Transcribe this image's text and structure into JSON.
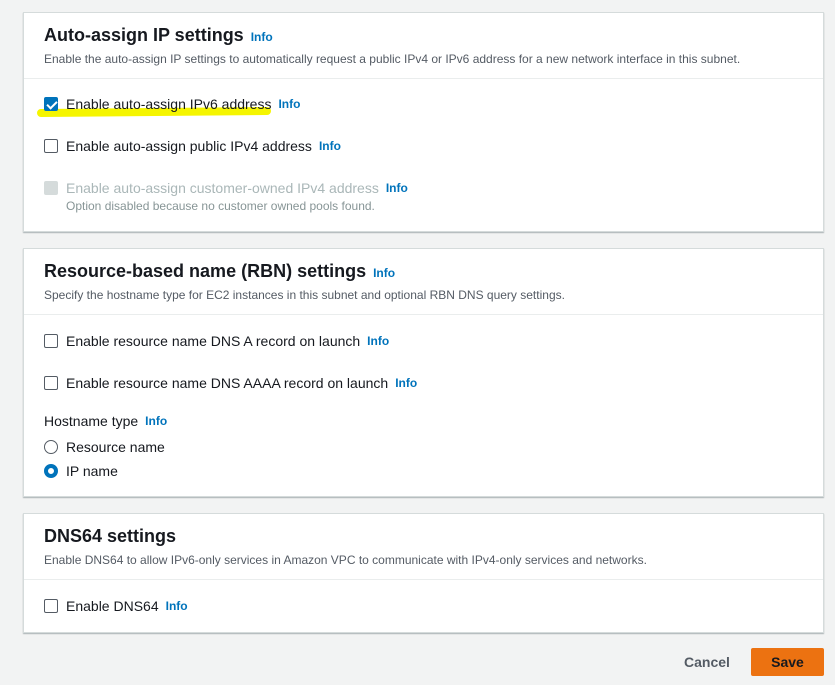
{
  "info_label": "Info",
  "auto_assign": {
    "title": "Auto-assign IP settings",
    "description": "Enable the auto-assign IP settings to automatically request a public IPv4 or IPv6 address for a new network interface in this subnet.",
    "ipv6_label": "Enable auto-assign IPv6 address",
    "ipv4_label": "Enable auto-assign public IPv4 address",
    "customer_owned_label": "Enable auto-assign customer-owned IPv4 address",
    "customer_owned_note": "Option disabled because no customer owned pools found.",
    "highlight_color": "#f5f500"
  },
  "rbn": {
    "title": "Resource-based name (RBN) settings",
    "description": "Specify the hostname type for EC2 instances in this subnet and optional RBN DNS query settings.",
    "dns_a_label": "Enable resource name DNS A record on launch",
    "dns_aaaa_label": "Enable resource name DNS AAAA record on launch",
    "hostname_type_label": "Hostname type",
    "options": [
      "Resource name",
      "IP name"
    ],
    "selected": "IP name"
  },
  "dns64": {
    "title": "DNS64 settings",
    "description": "Enable DNS64 to allow IPv6-only services in Amazon VPC to communicate with IPv4-only services and networks.",
    "enable_label": "Enable DNS64"
  },
  "footer": {
    "cancel_label": "Cancel",
    "save_label": "Save"
  },
  "colors": {
    "accent": "#0073bb",
    "primary_button": "#ec7211"
  }
}
